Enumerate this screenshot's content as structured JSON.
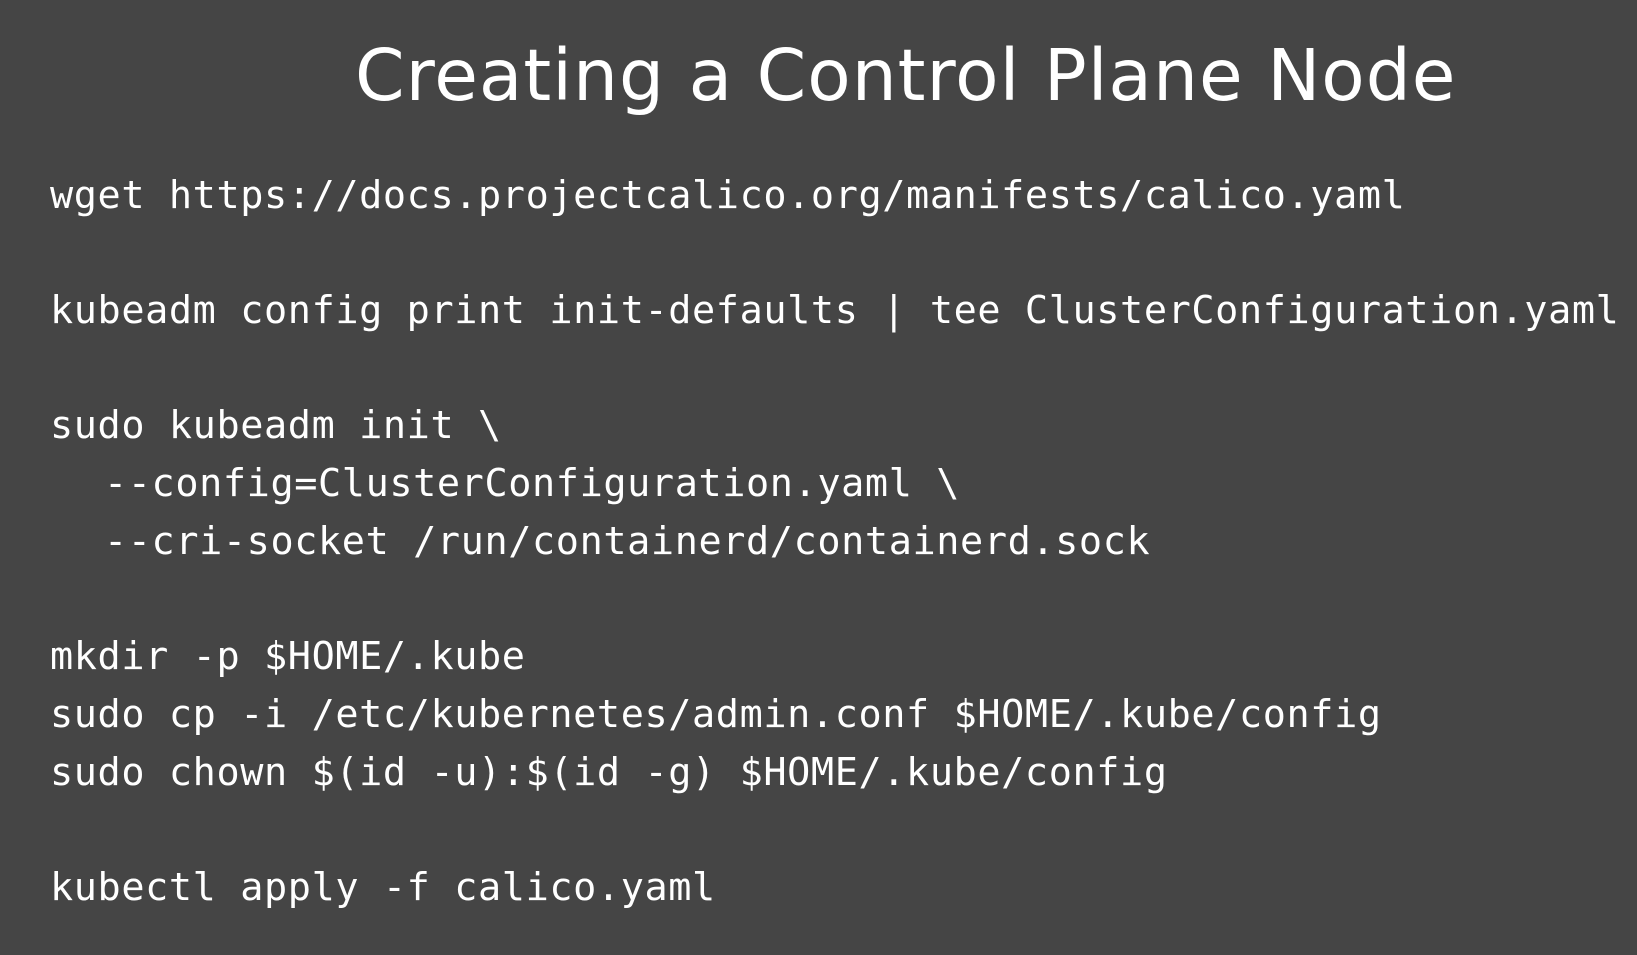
{
  "slide": {
    "title": "Creating a Control Plane Node",
    "background_color": "#454545",
    "text_color": "#ffffff",
    "code_lines": [
      "wget https://docs.projectcalico.org/manifests/calico.yaml",
      "kubeadm config print init-defaults | tee ClusterConfiguration.yaml",
      "sudo kubeadm init \\",
      "--config=ClusterConfiguration.yaml \\",
      "--cri-socket /run/containerd/containerd.sock",
      "mkdir -p $HOME/.kube",
      "sudo cp -i /etc/kubernetes/admin.conf $HOME/.kube/config",
      "sudo chown $(id -u):$(id -g) $HOME/.kube/config",
      "kubectl apply -f calico.yaml"
    ]
  }
}
